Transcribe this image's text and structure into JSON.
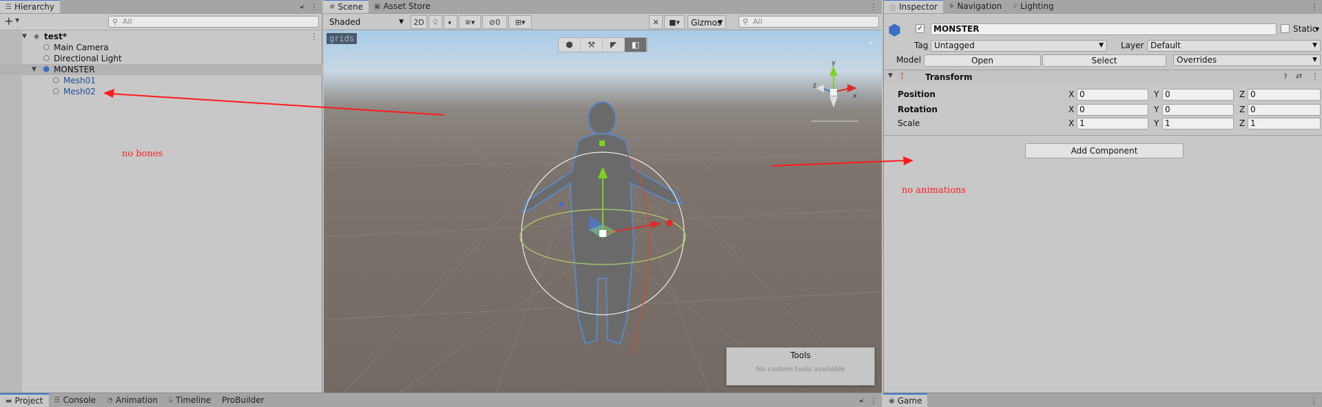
{
  "hierarchy": {
    "tab_label": "Hierarchy",
    "add_label": "+",
    "search_placeholder": "All",
    "rows": [
      {
        "label": "test*"
      },
      {
        "label": "Main Camera"
      },
      {
        "label": "Directional Light"
      },
      {
        "label": "MONSTER"
      },
      {
        "label": "Mesh01"
      },
      {
        "label": "Mesh02"
      }
    ],
    "note": "no bones"
  },
  "scene": {
    "tabs": [
      {
        "label": "Scene"
      },
      {
        "label": "Asset Store"
      }
    ],
    "shading_mode": "Shaded",
    "mode_2d": "2D",
    "hidden_count": "0",
    "gizmos_label": "Gizmos",
    "search_placeholder": "All",
    "grid_label": "grids",
    "gizmo_axis_y": "y",
    "gizmo_axis_z": "z",
    "gizmo_axis_x": "x",
    "tools_title": "Tools",
    "tools_message": "No custom tools available"
  },
  "inspector": {
    "tabs": [
      {
        "label": "Inspector"
      },
      {
        "label": "Navigation"
      },
      {
        "label": "Lighting"
      }
    ],
    "object_name": "MONSTER",
    "static_label": "Static",
    "tag_label": "Tag",
    "tag_value": "Untagged",
    "layer_label": "Layer",
    "layer_value": "Default",
    "model_label": "Model",
    "open_label": "Open",
    "select_label": "Select",
    "overrides_label": "Overrides",
    "transform_title": "Transform",
    "position_label": "Position",
    "rotation_label": "Rotation",
    "scale_label": "Scale",
    "axis_x": "X",
    "axis_y": "Y",
    "axis_z": "Z",
    "position": {
      "x": "0",
      "y": "0",
      "z": "0"
    },
    "rotation": {
      "x": "0",
      "y": "0",
      "z": "0"
    },
    "scale": {
      "x": "1",
      "y": "1",
      "z": "1"
    },
    "add_component_label": "Add Component",
    "note": "no animations"
  },
  "bottom": {
    "tabs_left": [
      {
        "label": "Project"
      },
      {
        "label": "Console"
      },
      {
        "label": "Animation"
      },
      {
        "label": "Timeline"
      },
      {
        "label": "ProBuilder"
      }
    ],
    "tab_right": "Game"
  },
  "colors": {
    "annotation": "#ff1a1a",
    "selection_accent": "#3a79d4",
    "prefab_blue": "#1b4d9b"
  }
}
